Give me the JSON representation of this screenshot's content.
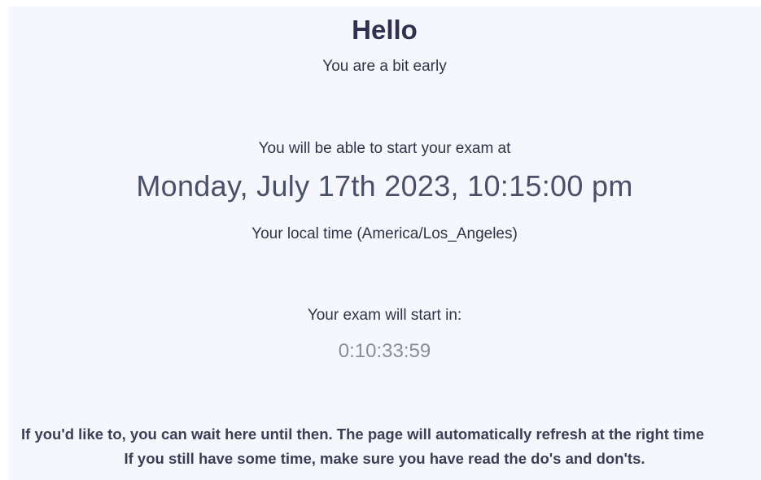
{
  "greeting": {
    "title": "Hello",
    "subtitle": "You are a bit early"
  },
  "schedule": {
    "start_label": "You will be able to start your exam at",
    "start_datetime": "Monday, July 17th 2023, 10:15:00 pm",
    "timezone_note": "Your local time (America/Los_Angeles)"
  },
  "countdown": {
    "label": "Your exam will start in:",
    "value": "0:10:33:59"
  },
  "info": {
    "line1": "If you'd like to, you can wait here until then. The page will automatically refresh at the right time",
    "line2": "If you still have some time, make sure you have read the do's and don'ts."
  }
}
